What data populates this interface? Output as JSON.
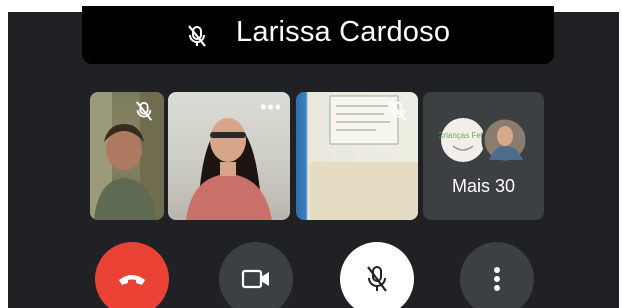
{
  "participant": {
    "name": "Larissa Cardoso",
    "more_label": "Mais 30",
    "logo_text": "Crianças Feliz"
  },
  "icons": {
    "banner_mic": "mic-off-icon",
    "end_call": "phone-hangup-icon",
    "camera": "video-camera-icon",
    "microphone": "mic-off-icon",
    "more": "more-vert-icon"
  },
  "colors": {
    "background": "#202124",
    "end_call": "#ea4335",
    "control_bg": "#3c4043",
    "mic_active_bg": "#ffffff"
  }
}
